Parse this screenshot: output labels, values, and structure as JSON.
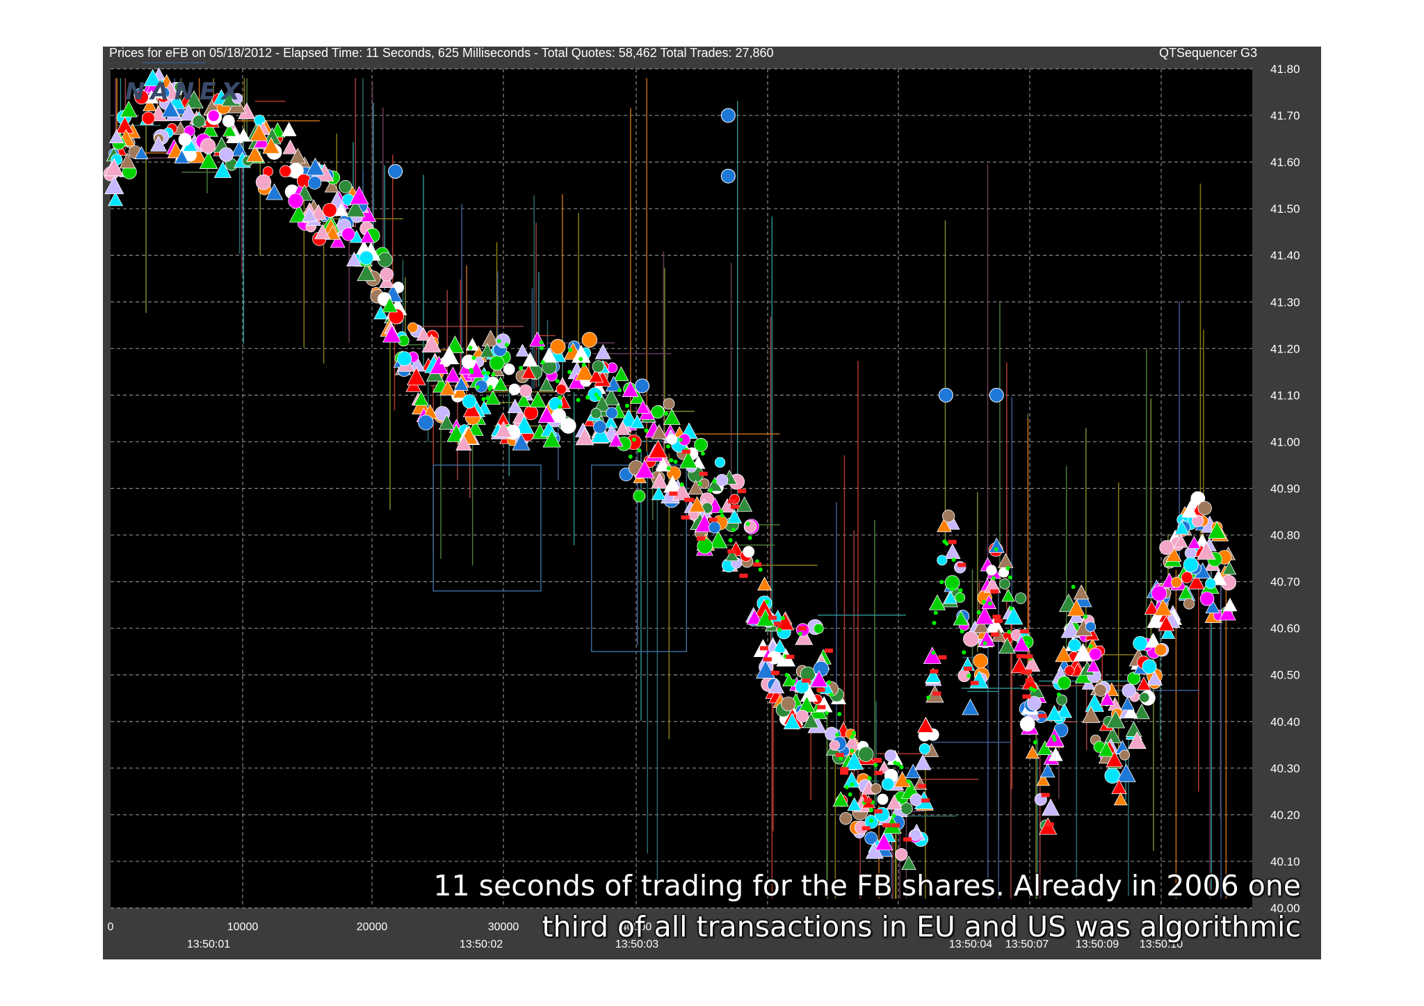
{
  "header": {
    "left": "Prices for  eFB  on  05/18/2012  -  Elapsed Time: 11 Seconds, 625 Milliseconds  -  Total Quotes: 58,462  Total Trades: 27,860",
    "right": "QTSequencer G3"
  },
  "logo_text": "NANEX",
  "caption_line1": "11 seconds of trading for the FB shares. Already in 2006 one",
  "caption_line2": "third of all transactions in EU and US was algorithmic",
  "colors": {
    "background": "#000000",
    "frame": "#3c3c3c",
    "grid": "#9a9a9a",
    "text": "#ffffff"
  },
  "chart_data": {
    "type": "scatter",
    "title": "Prices for  eFB  on  05/18/2012  -  Elapsed Time: 11 Seconds, 625 Milliseconds  -  Total Quotes: 58,462  Total Trades: 27,860",
    "xlabel": "",
    "ylabel": "",
    "ylim": [
      40.0,
      41.8
    ],
    "xlim": [
      0,
      44000
    ],
    "grid": true,
    "y_ticks": [
      "40.00",
      "40.10",
      "40.20",
      "40.30",
      "40.40",
      "40.50",
      "40.60",
      "40.70",
      "40.80",
      "40.90",
      "41.00",
      "41.10",
      "41.20",
      "41.30",
      "41.40",
      "41.50",
      "41.60",
      "41.70",
      "41.80"
    ],
    "x_ticks": [
      {
        "x": 0,
        "label": "0"
      },
      {
        "x": 10000,
        "label": "10000"
      },
      {
        "x": 20000,
        "label": "20000"
      },
      {
        "x": 30000,
        "label": "30000"
      },
      {
        "x": 40000,
        "label": "40000"
      }
    ],
    "time_labels": [
      {
        "x": 7500,
        "label": "13:50:01"
      },
      {
        "x": 28500,
        "label": "13:50:02"
      },
      {
        "x": 40500,
        "label": "13:50:03"
      },
      {
        "x": 66200,
        "label": "13:50:04"
      },
      {
        "x": 70700,
        "label": "13:50:07"
      },
      {
        "x": 76000,
        "label": "13:50:09"
      },
      {
        "x": 80800,
        "label": "13:50:10"
      }
    ],
    "x_visible_max": 88500,
    "price_path": {
      "x": [
        0,
        2000,
        4000,
        6000,
        8000,
        10000,
        12000,
        14000,
        16000,
        18000,
        20000,
        22000,
        24000,
        26000,
        28000,
        30000,
        32000,
        34000,
        36000,
        38000,
        40000,
        42000,
        44000,
        46000,
        48000,
        50000,
        52000,
        54000,
        56000,
        58000,
        60000,
        62000,
        64000,
        66000,
        68000,
        70000,
        72000,
        74000,
        76000,
        78000,
        80000,
        82000,
        84000,
        86000,
        88000
      ],
      "y": [
        41.58,
        41.66,
        41.72,
        41.68,
        41.66,
        41.66,
        41.62,
        41.6,
        41.52,
        41.48,
        41.45,
        41.3,
        41.18,
        41.1,
        41.1,
        41.12,
        41.1,
        41.12,
        41.1,
        41.12,
        41.05,
        40.98,
        40.98,
        40.9,
        40.85,
        40.8,
        40.55,
        40.5,
        40.5,
        40.3,
        40.22,
        40.22,
        40.18,
        40.8,
        40.5,
        40.7,
        40.55,
        40.25,
        40.65,
        40.45,
        40.32,
        40.55,
        40.72,
        40.78,
        40.7
      ]
    }
  }
}
